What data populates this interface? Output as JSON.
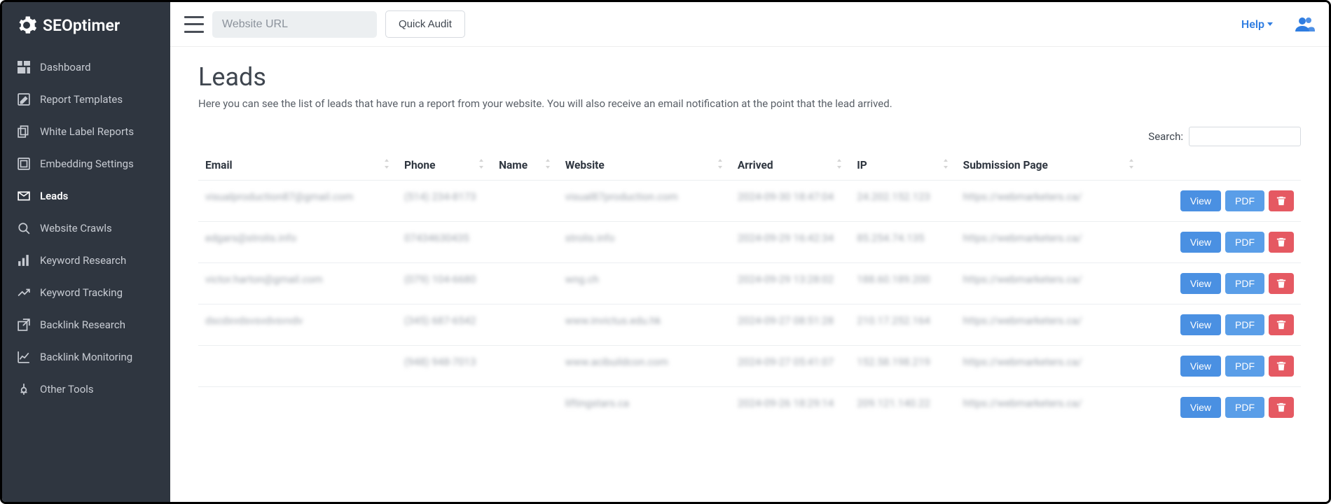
{
  "brand": {
    "name": "SEOptimer"
  },
  "sidebar": {
    "items": [
      {
        "label": "Dashboard",
        "icon": "dashboard-icon"
      },
      {
        "label": "Report Templates",
        "icon": "edit-icon"
      },
      {
        "label": "White Label Reports",
        "icon": "file-copy-icon"
      },
      {
        "label": "Embedding Settings",
        "icon": "embed-icon"
      },
      {
        "label": "Leads",
        "icon": "mail-icon"
      },
      {
        "label": "Website Crawls",
        "icon": "magnify-icon"
      },
      {
        "label": "Keyword Research",
        "icon": "bar-chart-icon"
      },
      {
        "label": "Keyword Tracking",
        "icon": "trend-icon"
      },
      {
        "label": "Backlink Research",
        "icon": "external-link-icon"
      },
      {
        "label": "Backlink Monitoring",
        "icon": "line-chart-icon"
      },
      {
        "label": "Other Tools",
        "icon": "tool-icon"
      }
    ],
    "active_index": 4
  },
  "topbar": {
    "url_placeholder": "Website URL",
    "quick_audit_label": "Quick Audit",
    "help_label": "Help"
  },
  "page": {
    "title": "Leads",
    "description": "Here you can see the list of leads that have run a report from your website. You will also receive an email notification at the point that the lead arrived."
  },
  "search": {
    "label": "Search:",
    "value": ""
  },
  "table": {
    "columns": [
      "Email",
      "Phone",
      "Name",
      "Website",
      "Arrived",
      "IP",
      "Submission Page",
      ""
    ],
    "actions": {
      "view_label": "View",
      "pdf_label": "PDF"
    },
    "rows": [
      {
        "email": "visualproduction87@gmail.com",
        "phone": "(514) 234-8173",
        "name": "",
        "website": "visual87production.com",
        "arrived": "2024-09-30 18:47:04",
        "ip": "24.202.152.123",
        "submission": "https://webmarketers.ca/"
      },
      {
        "email": "edgars@strolis.info",
        "phone": "07434630435",
        "name": "",
        "website": "strolis.info",
        "arrived": "2024-09-29 16:42:34",
        "ip": "85.254.74.135",
        "submission": "https://webmarketers.ca/"
      },
      {
        "email": "victor.harton@gmail.com",
        "phone": "(079) 104-6680",
        "name": "",
        "website": "wng.ch",
        "arrived": "2024-09-29 13:28:02",
        "ip": "188.60.189.200",
        "submission": "https://webmarketers.ca/"
      },
      {
        "email": "dscdxvdsvsvdvsvvdv",
        "phone": "(345) 687-6542",
        "name": "",
        "website": "www.invictus.edu.hk",
        "arrived": "2024-09-27 08:51:28",
        "ip": "210.17.252.164",
        "submission": "https://webmarketers.ca/"
      },
      {
        "email": "",
        "phone": "(948) 948-7013",
        "name": "",
        "website": "www.acibuildcon.com",
        "arrived": "2024-09-27 05:41:07",
        "ip": "152.58.198.219",
        "submission": "https://webmarketers.ca/"
      },
      {
        "email": "",
        "phone": "",
        "name": "",
        "website": "liftingstars.ca",
        "arrived": "2024-09-26 18:29:14",
        "ip": "209.121.140.22",
        "submission": "https://webmarketers.ca/"
      }
    ]
  }
}
